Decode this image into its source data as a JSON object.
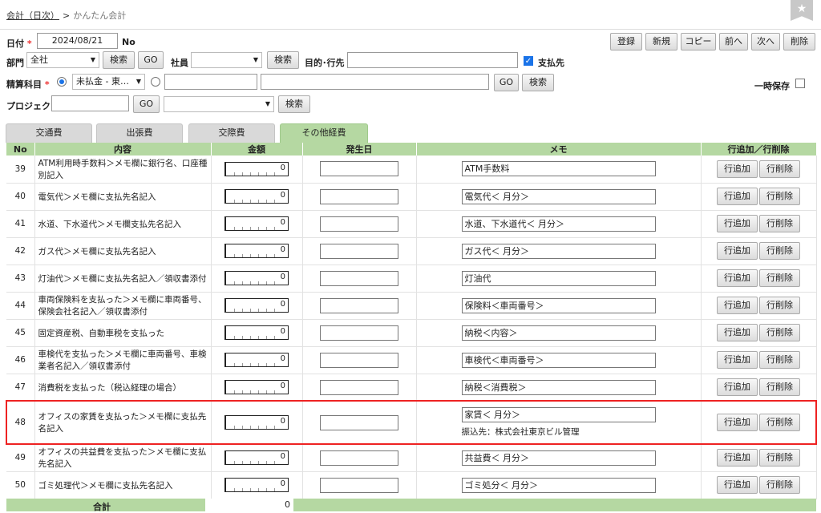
{
  "breadcrumb": {
    "link": "会計（日次）",
    "sep": ">",
    "current": "かんたん会計"
  },
  "form": {
    "date_label": "日付",
    "date_value": "2024/08/21",
    "no_label": "No",
    "dept_label": "部門",
    "dept_value": "全社",
    "search": "検索",
    "go": "GO",
    "staff_label": "社員",
    "purpose_label": "目的･行先",
    "payee_label": "支払先",
    "account_label": "精算科目",
    "account_value": "未払金 - 東…",
    "temp_save_label": "一時保存",
    "project_label": "プロジェクト",
    "required_mark": "*"
  },
  "toolbar": {
    "register": "登録",
    "new": "新規",
    "copy": "コピー",
    "prev": "前へ",
    "next": "次へ",
    "delete": "削除"
  },
  "tabs": [
    "交通費",
    "出張費",
    "交際費",
    "その他経費"
  ],
  "columns": {
    "no": "No",
    "content": "内容",
    "amount": "金額",
    "date": "発生日",
    "memo": "メモ",
    "action": "行追加／行削除"
  },
  "row_add": "行追加",
  "row_del": "行削除",
  "rows": [
    {
      "no": "39",
      "content": "ATM利用時手数料＞メモ欄に銀行名、口座種別記入",
      "amount": "0",
      "memo": "ATM手数料"
    },
    {
      "no": "40",
      "content": "電気代＞メモ欄に支払先名記入",
      "amount": "0",
      "memo": "電気代＜ 月分＞"
    },
    {
      "no": "41",
      "content": "水道、下水道代＞メモ欄支払先名記入",
      "amount": "0",
      "memo": "水道、下水道代＜ 月分＞"
    },
    {
      "no": "42",
      "content": "ガス代＞メモ欄に支払先名記入",
      "amount": "0",
      "memo": "ガス代＜ 月分＞"
    },
    {
      "no": "43",
      "content": "灯油代＞メモ欄に支払先名記入／領収書添付",
      "amount": "0",
      "memo": "灯油代"
    },
    {
      "no": "44",
      "content": "車両保険料を支払った＞メモ欄に車両番号、保険会社名記入／領収書添付",
      "amount": "0",
      "memo": "保険料＜車両番号＞"
    },
    {
      "no": "45",
      "content": "固定資産税、自動車税を支払った",
      "amount": "0",
      "memo": "納税＜内容＞"
    },
    {
      "no": "46",
      "content": "車検代を支払った＞メモ欄に車両番号、車検業者名記入／領収書添付",
      "amount": "0",
      "memo": "車検代＜車両番号＞"
    },
    {
      "no": "47",
      "content": "消費税を支払った（税込経理の場合）",
      "amount": "0",
      "memo": "納税＜消費税＞"
    },
    {
      "no": "48",
      "content": "オフィスの家賃を支払った＞メモ欄に支払先名記入",
      "amount": "0",
      "memo": "家賃＜ 月分＞",
      "sub": "振込先：株式会社東京ビル管理"
    },
    {
      "no": "49",
      "content": "オフィスの共益費を支払った＞メモ欄に支払先名記入",
      "amount": "0",
      "memo": "共益費＜ 月分＞"
    },
    {
      "no": "50",
      "content": "ゴミ処理代＞メモ欄に支払先名記入",
      "amount": "0",
      "memo": "ゴミ処分＜ 月分＞"
    }
  ],
  "total": {
    "label": "合計",
    "value": "0"
  },
  "colors": {
    "header_green": "#b5d8a2",
    "highlight": "#e22222"
  }
}
